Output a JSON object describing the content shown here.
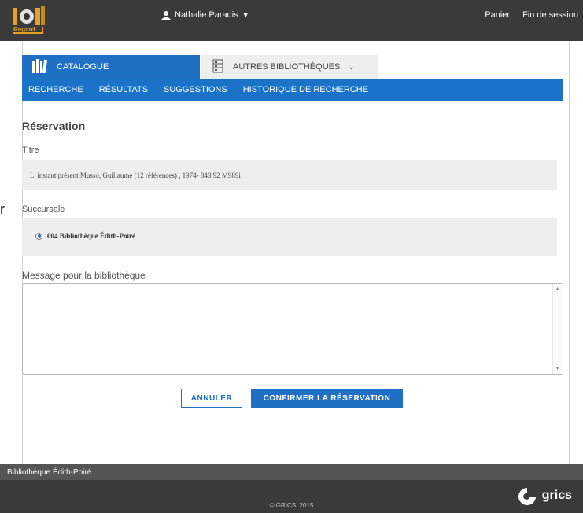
{
  "header": {
    "logo_text": "Regard",
    "user_name": "Nathalie Paradis",
    "user_caret": "▼",
    "links": [
      "Panier",
      "Fin de session"
    ]
  },
  "side_fragment": "r",
  "tabs": {
    "catalogue": "CATALOGUE",
    "autres": "AUTRES BIBLIOTHÈQUES",
    "autres_chevron": "⌄"
  },
  "subnav": [
    "RECHERCHE",
    "RÉSULTATS",
    "SUGGESTIONS",
    "HISTORIQUE DE RECHERCHE"
  ],
  "form": {
    "heading": "Réservation",
    "titre_label": "Titre",
    "titre_value": "L' instant présent Musso, Guillaume (12 références) , 1974- 848.92 M989i",
    "succursale_label": "Succursale",
    "succursale_option": "004 Bibliothèque Édith-Poiré",
    "message_label": "Message pour la bibliothèque",
    "message_value": ""
  },
  "buttons": {
    "cancel": "ANNULER",
    "confirm": "CONFIRMER LA RÉSERVATION"
  },
  "footer": {
    "library": "Bibliothèque Édith-Poiré",
    "copyright": "© GRICS, 2015",
    "brand": "grics"
  },
  "colors": {
    "accent": "#1f6fc5",
    "topbar": "#3a3a3a",
    "panel": "#eeeeee"
  }
}
